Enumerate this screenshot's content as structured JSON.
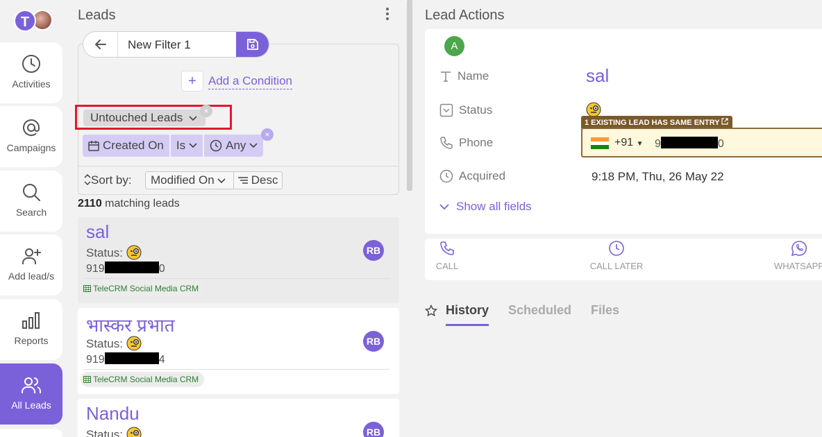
{
  "nav": {
    "avatar_letter": "T",
    "items": [
      {
        "label": "Activities",
        "icon": "clock-icon"
      },
      {
        "label": "Campaigns",
        "icon": "at-icon"
      },
      {
        "label": "Search",
        "icon": "search-icon"
      },
      {
        "label": "Add lead/s",
        "icon": "add-user-icon"
      },
      {
        "label": "Reports",
        "icon": "bar-chart-icon"
      },
      {
        "label": "All Leads",
        "icon": "users-icon",
        "active": true
      }
    ]
  },
  "leads": {
    "title": "Leads",
    "filter": {
      "name": "New Filter 1",
      "add_condition": "Add a Condition",
      "preset_chip": "Untouched Leads",
      "condition": {
        "field": "Created On",
        "operator": "Is",
        "value": "Any"
      },
      "remove_symbol": "×",
      "add_symbol": "+"
    },
    "sort": {
      "label": "Sort by:",
      "field": "Modified On",
      "order": "Desc"
    },
    "match_count": "2110",
    "match_suffix": " matching leads",
    "status_label": "Status:",
    "items": [
      {
        "name": "sal",
        "phone_prefix": "919",
        "phone_suffix": "0",
        "source": "TeleCRM Social Media CRM",
        "assignee": "RB",
        "selected": true
      },
      {
        "name": "भास्कर प्रभात",
        "phone_prefix": "919",
        "phone_suffix": "4",
        "source": "TeleCRM Social Media CRM",
        "assignee": "RB"
      },
      {
        "name": "Nandu",
        "assignee": "RB"
      }
    ]
  },
  "lead_actions": {
    "title": "Lead Actions",
    "avatar_letter": "A",
    "fields": {
      "name_label": "Name",
      "name_value": "sal",
      "status_label": "Status",
      "phone_label": "Phone",
      "acquired_label": "Acquired",
      "acquired_value": "9:18 PM, Thu, 26 May 22"
    },
    "duplicate_notice": "1 EXISTING LEAD HAS SAME ENTRY",
    "phone": {
      "country_code": "+91",
      "prefix": "9",
      "suffix": "0"
    },
    "show_all": "Show all fields",
    "actions": [
      {
        "label": "CALL",
        "icon": "phone-icon"
      },
      {
        "label": "CALL LATER",
        "icon": "clock-icon"
      },
      {
        "label": "WHATSAPP",
        "icon": "whatsapp-icon"
      }
    ],
    "tabs": [
      "History",
      "Scheduled",
      "Files"
    ],
    "active_tab": "History"
  },
  "colors": {
    "accent": "#7b61d9",
    "highlight": "#e0192b",
    "bg": "#f2f2f2"
  }
}
